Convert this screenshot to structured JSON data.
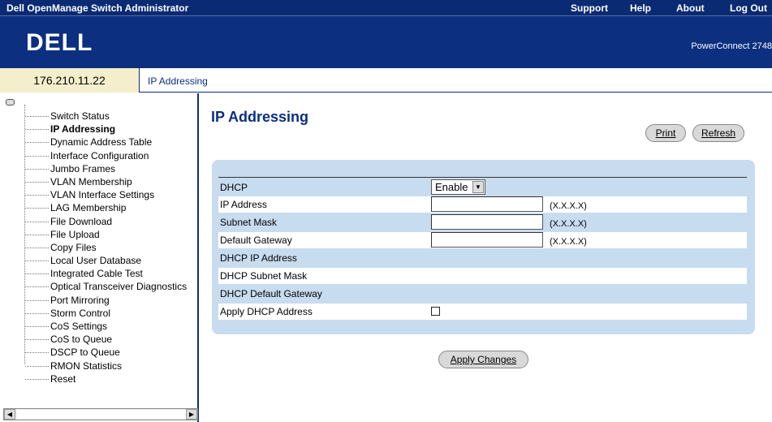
{
  "topbar": {
    "title": "Dell OpenManage Switch Administrator",
    "menu": [
      {
        "label": "Support"
      },
      {
        "label": "Help"
      },
      {
        "label": "About"
      },
      {
        "label": "Log Out"
      }
    ]
  },
  "banner": {
    "logo": "DELL",
    "product": "PowerConnect 2748"
  },
  "breadcrumb": {
    "ip": "176.210.11.22",
    "page": "IP Addressing"
  },
  "tree": {
    "items": [
      {
        "label": "Switch Status"
      },
      {
        "label": "IP Addressing",
        "active": true
      },
      {
        "label": "Dynamic Address Table"
      },
      {
        "label": "Interface Configuration"
      },
      {
        "label": "Jumbo Frames"
      },
      {
        "label": "VLAN Membership"
      },
      {
        "label": "VLAN Interface Settings"
      },
      {
        "label": "LAG Membership"
      },
      {
        "label": "File Download"
      },
      {
        "label": "File Upload"
      },
      {
        "label": "Copy Files"
      },
      {
        "label": "Local User Database"
      },
      {
        "label": "Integrated Cable Test"
      },
      {
        "label": "Optical Transceiver Diagnostics"
      },
      {
        "label": "Port Mirroring"
      },
      {
        "label": "Storm Control"
      },
      {
        "label": "CoS Settings"
      },
      {
        "label": "CoS to Queue"
      },
      {
        "label": "DSCP to Queue"
      },
      {
        "label": "RMON Statistics"
      },
      {
        "label": "Reset"
      }
    ]
  },
  "main": {
    "title": "IP Addressing",
    "print_label": "Print",
    "refresh_label": "Refresh",
    "apply_label": "Apply Changes",
    "form": {
      "dhcp_label": "DHCP",
      "dhcp_value": "Enable",
      "ip_label": "IP Address",
      "ip_value": "",
      "subnet_label": "Subnet Mask",
      "subnet_value": "",
      "gateway_label": "Default Gateway",
      "gateway_value": "",
      "format_hint": "(X.X.X.X)",
      "dhcp_ip_label": "DHCP IP Address",
      "dhcp_subnet_label": "DHCP Subnet Mask",
      "dhcp_gateway_label": "DHCP Default Gateway",
      "apply_dhcp_label": "Apply DHCP Address",
      "apply_dhcp_checked": false
    }
  },
  "colors": {
    "navy": "#0c2f80",
    "panel": "#c8dcf0",
    "ip_box": "#f4eecc"
  }
}
